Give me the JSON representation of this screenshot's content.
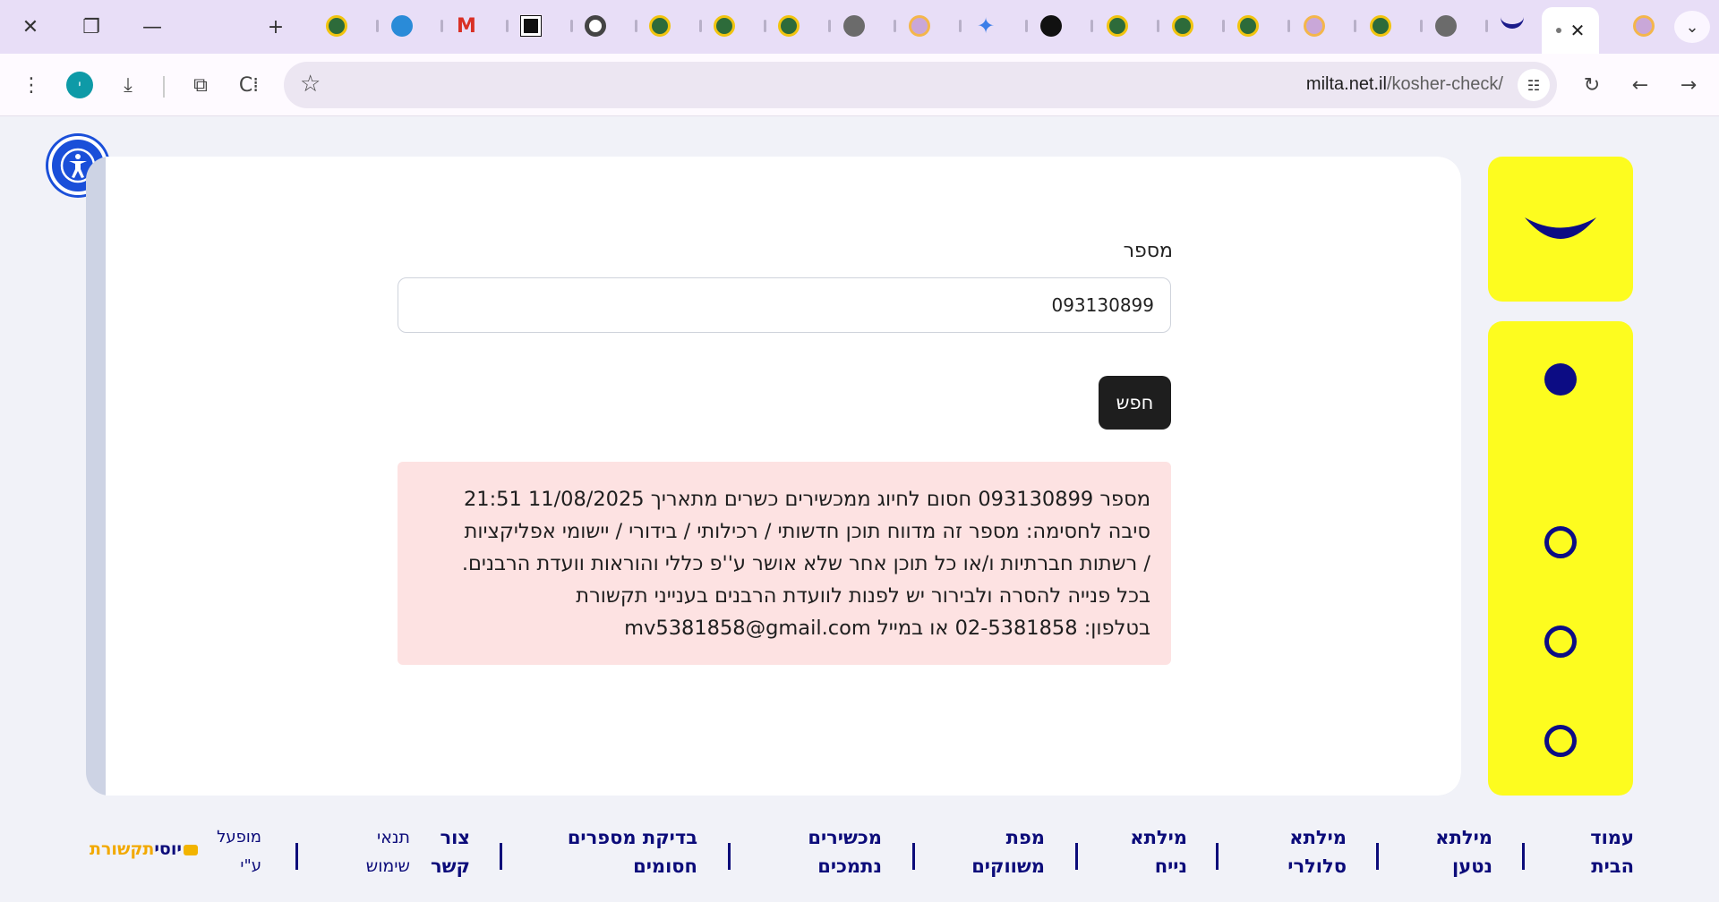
{
  "browser": {
    "url_host": "milta.net.il",
    "url_path": "/kosher-check/"
  },
  "form": {
    "number_label": "מספר",
    "number_value": "093130899",
    "search_label": "חפש"
  },
  "result": {
    "color": "#fde2e2",
    "lines": [
      "מספר 093130899 חסום לחיוג ממכשירים כשרים מתאריך 11/08/2025 21:51",
      "סיבה לחסימה: מספר זה מדווח תוכן חדשותי / רכילותי / בידורי / יישומי אפליקציות",
      "/ רשתות חברתיות ו/או כל תוכן אחר שלא אושר ע''פ כללי והוראות וועדת הרבנים.",
      "בכל פנייה להסרה ולבירור יש לפנות לוועדת הרבנים בענייני תקשורת",
      "בטלפון: 02-5381858 או במייל mv5381858@gmail.com"
    ]
  },
  "sidebar": {
    "accent": "#fdfc1f",
    "dot_color": "#0c0c84"
  },
  "footer": {
    "items": [
      {
        "line1": "עמוד",
        "line2": "הבית"
      },
      {
        "line1": "מילתא",
        "line2": "נטען"
      },
      {
        "line1": "מילתא",
        "line2": "סלולרי"
      },
      {
        "line1": "מילתא",
        "line2": "נייח"
      },
      {
        "line1": "מפת",
        "line2": "משווקים"
      },
      {
        "line1": "מכשירים",
        "line2": "נתמכים"
      },
      {
        "line1": "בדיקת מספרים",
        "line2": "חסומים"
      },
      {
        "line1": "צור",
        "line2": "קשר"
      },
      {
        "line1": "תנאי",
        "line2": "שימוש"
      }
    ],
    "credit_line1": "מופעל",
    "credit_line2": "ע\"י",
    "brand_part1": "יוסי",
    "brand_part2": "תקשורת"
  }
}
